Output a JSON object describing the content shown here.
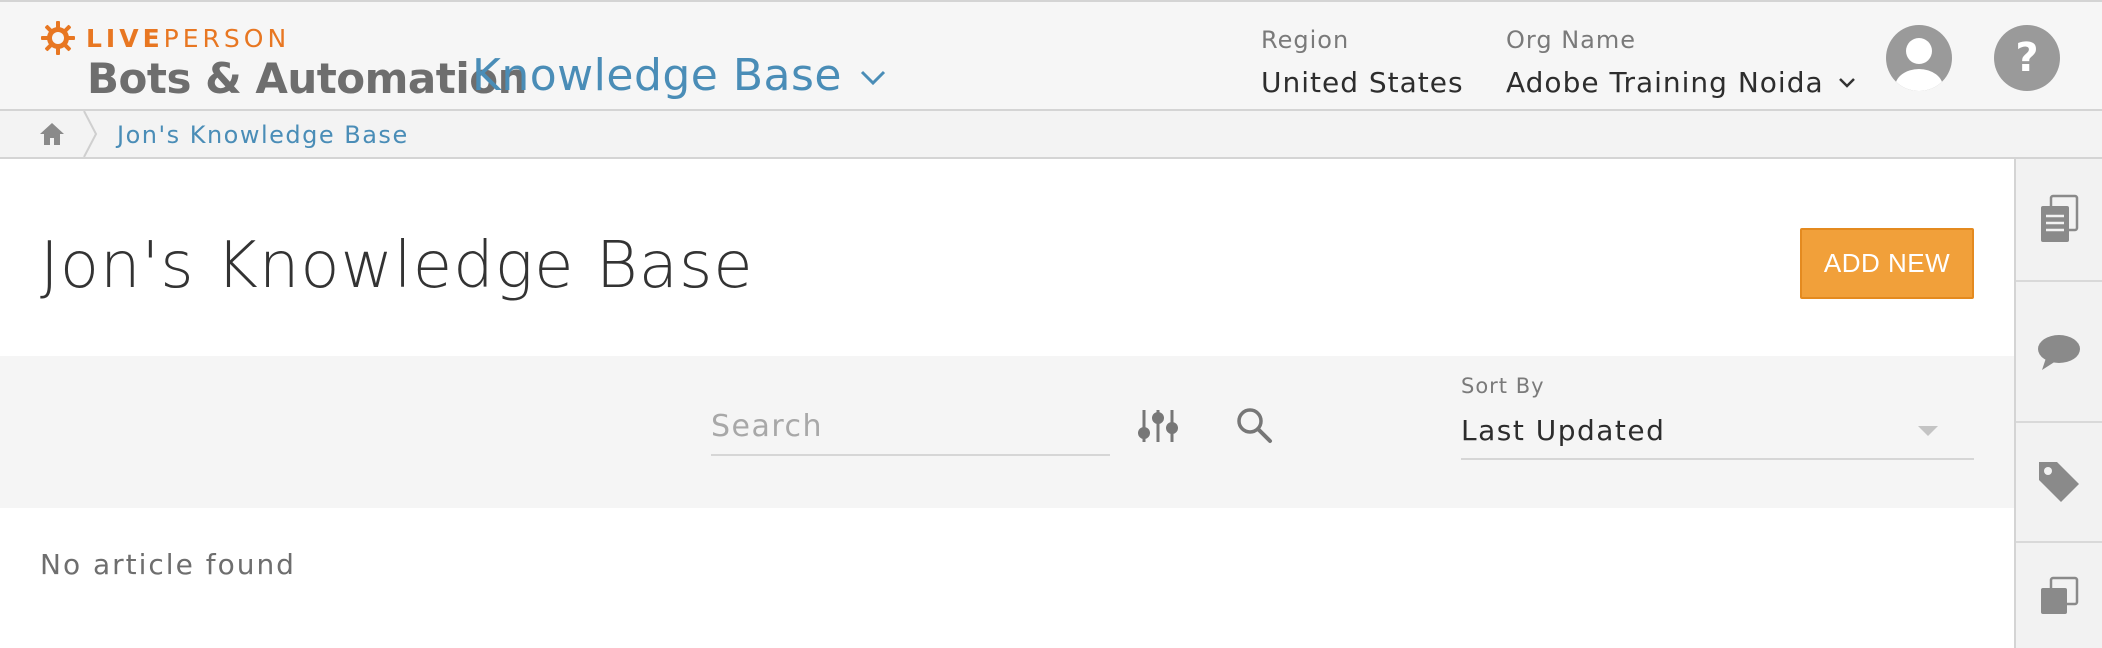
{
  "header": {
    "brand_bold": "LIVE",
    "brand_light": "PERSON",
    "app_title": "Bots & Automation",
    "kb_switch_label": "Knowledge Base",
    "region_label": "Region",
    "region_value": "United States",
    "org_label": "Org Name",
    "org_value": "Adobe Training Noida",
    "help_glyph": "?"
  },
  "breadcrumb": {
    "current": "Jon's Knowledge Base"
  },
  "main": {
    "page_title": "Jon's Knowledge Base",
    "add_button": "ADD NEW",
    "search_placeholder": "Search",
    "sort_label": "Sort By",
    "sort_value": "Last Updated",
    "empty_message": "No article found"
  },
  "right_rail": {
    "items": [
      {
        "icon": "articles-icon"
      },
      {
        "icon": "chat-bubble-icon"
      },
      {
        "icon": "tag-icon"
      },
      {
        "icon": "copy-icon"
      }
    ]
  },
  "colors": {
    "brand_orange": "#e87722",
    "accent_blue": "#4a8db7",
    "button_orange": "#f1a03a",
    "icon_gray": "#9a9a9a"
  }
}
